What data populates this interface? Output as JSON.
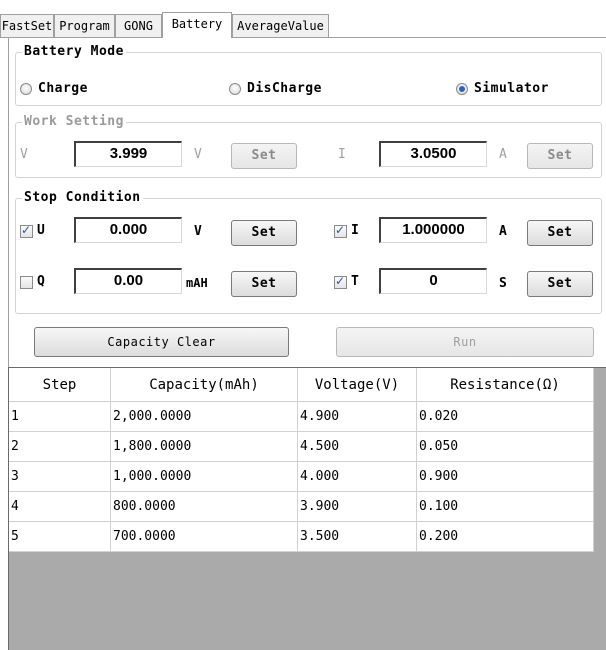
{
  "tabs": [
    {
      "label": "FastSet",
      "active": false
    },
    {
      "label": "Program",
      "active": false
    },
    {
      "label": "GONG",
      "active": false
    },
    {
      "label": "Battery",
      "active": true
    },
    {
      "label": "AverageValue",
      "active": false
    }
  ],
  "battery_mode": {
    "title": "Battery Mode",
    "options": [
      {
        "label": "Charge",
        "selected": false
      },
      {
        "label": "DisCharge",
        "selected": false
      },
      {
        "label": "Simulator",
        "selected": true
      }
    ]
  },
  "work_setting": {
    "title": "Work Setting",
    "v_label": "V",
    "v_value": "3.999",
    "v_unit": "V",
    "v_set": "Set",
    "i_label": "I",
    "i_value": "3.0500",
    "i_unit": "A",
    "i_set": "Set"
  },
  "stop_condition": {
    "title": "Stop Condition",
    "u": {
      "label": "U",
      "checked": true,
      "value": "0.000",
      "unit": "V",
      "set": "Set"
    },
    "i": {
      "label": "I",
      "checked": true,
      "value": "1.000000",
      "unit": "A",
      "set": "Set"
    },
    "q": {
      "label": "Q",
      "checked": false,
      "value": "0.00",
      "unit": "mAH",
      "set": "Set"
    },
    "t": {
      "label": "T",
      "checked": true,
      "value": "0",
      "unit": "S",
      "set": "Set"
    }
  },
  "actions": {
    "capacity_clear": "Capacity Clear",
    "run": "Run"
  },
  "table": {
    "headers": [
      "Step",
      "Capacity(mAh)",
      "Voltage(V)",
      "Resistance(Ω)"
    ],
    "rows": [
      [
        "1",
        "2,000.0000",
        "4.900",
        "0.020"
      ],
      [
        "2",
        "1,800.0000",
        "4.500",
        "0.050"
      ],
      [
        "3",
        "1,000.0000",
        "4.000",
        "0.900"
      ],
      [
        "4",
        "800.0000",
        "3.900",
        "0.100"
      ],
      [
        "5",
        "700.0000",
        "3.500",
        "0.200"
      ]
    ]
  }
}
